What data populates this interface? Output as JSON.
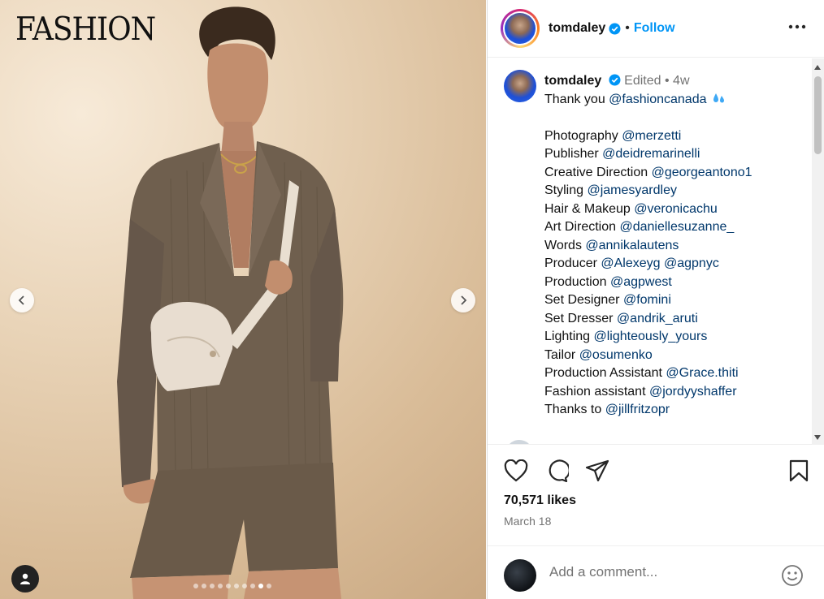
{
  "media": {
    "masthead": "FASHION",
    "carousel": {
      "total": 10,
      "active_index": 8
    }
  },
  "header": {
    "username": "tomdaley",
    "separator": "•",
    "follow_label": "Follow"
  },
  "caption": {
    "username": "tomdaley",
    "edited": "Edited",
    "separator": "•",
    "age": "4w",
    "thanks_text": "Thank you",
    "thanks_mention": "@fashioncanada",
    "credits": [
      {
        "role": "Photography",
        "handle": "@merzetti"
      },
      {
        "role": "Publisher",
        "handle": "@deidremarinelli"
      },
      {
        "role": "Creative Direction",
        "handle": "@georgeantono1"
      },
      {
        "role": "Styling",
        "handle": "@jamesyardley"
      },
      {
        "role": "Hair & Makeup",
        "handle": "@veronicachu"
      },
      {
        "role": "Art Direction",
        "handle": "@daniellesuzanne_"
      },
      {
        "role": "Words",
        "handle": "@annikalautens"
      },
      {
        "role": "Producer",
        "handle": "@Alexeyg @agpnyc"
      },
      {
        "role": "Production",
        "handle": "@agpwest"
      },
      {
        "role": "Set Designer",
        "handle": "@fomini"
      },
      {
        "role": "Set Dresser",
        "handle": "@andrik_aruti"
      },
      {
        "role": "Lighting",
        "handle": "@lighteously_yours"
      },
      {
        "role": "Tailor",
        "handle": "@osumenko"
      },
      {
        "role": "Production Assistant",
        "handle": "@Grace.thiti"
      },
      {
        "role": "Fashion assistant",
        "handle": "@jordyyshaffer"
      },
      {
        "role": "Thanks to",
        "handle": "@jillfritzopr"
      }
    ]
  },
  "engagement": {
    "likes": "70,571 likes",
    "date": "March 18"
  },
  "comment_box": {
    "placeholder": "Add a comment..."
  },
  "colors": {
    "link": "#00376b",
    "follow": "#0095f6",
    "verified": "#0095f6",
    "muted": "#737373"
  }
}
